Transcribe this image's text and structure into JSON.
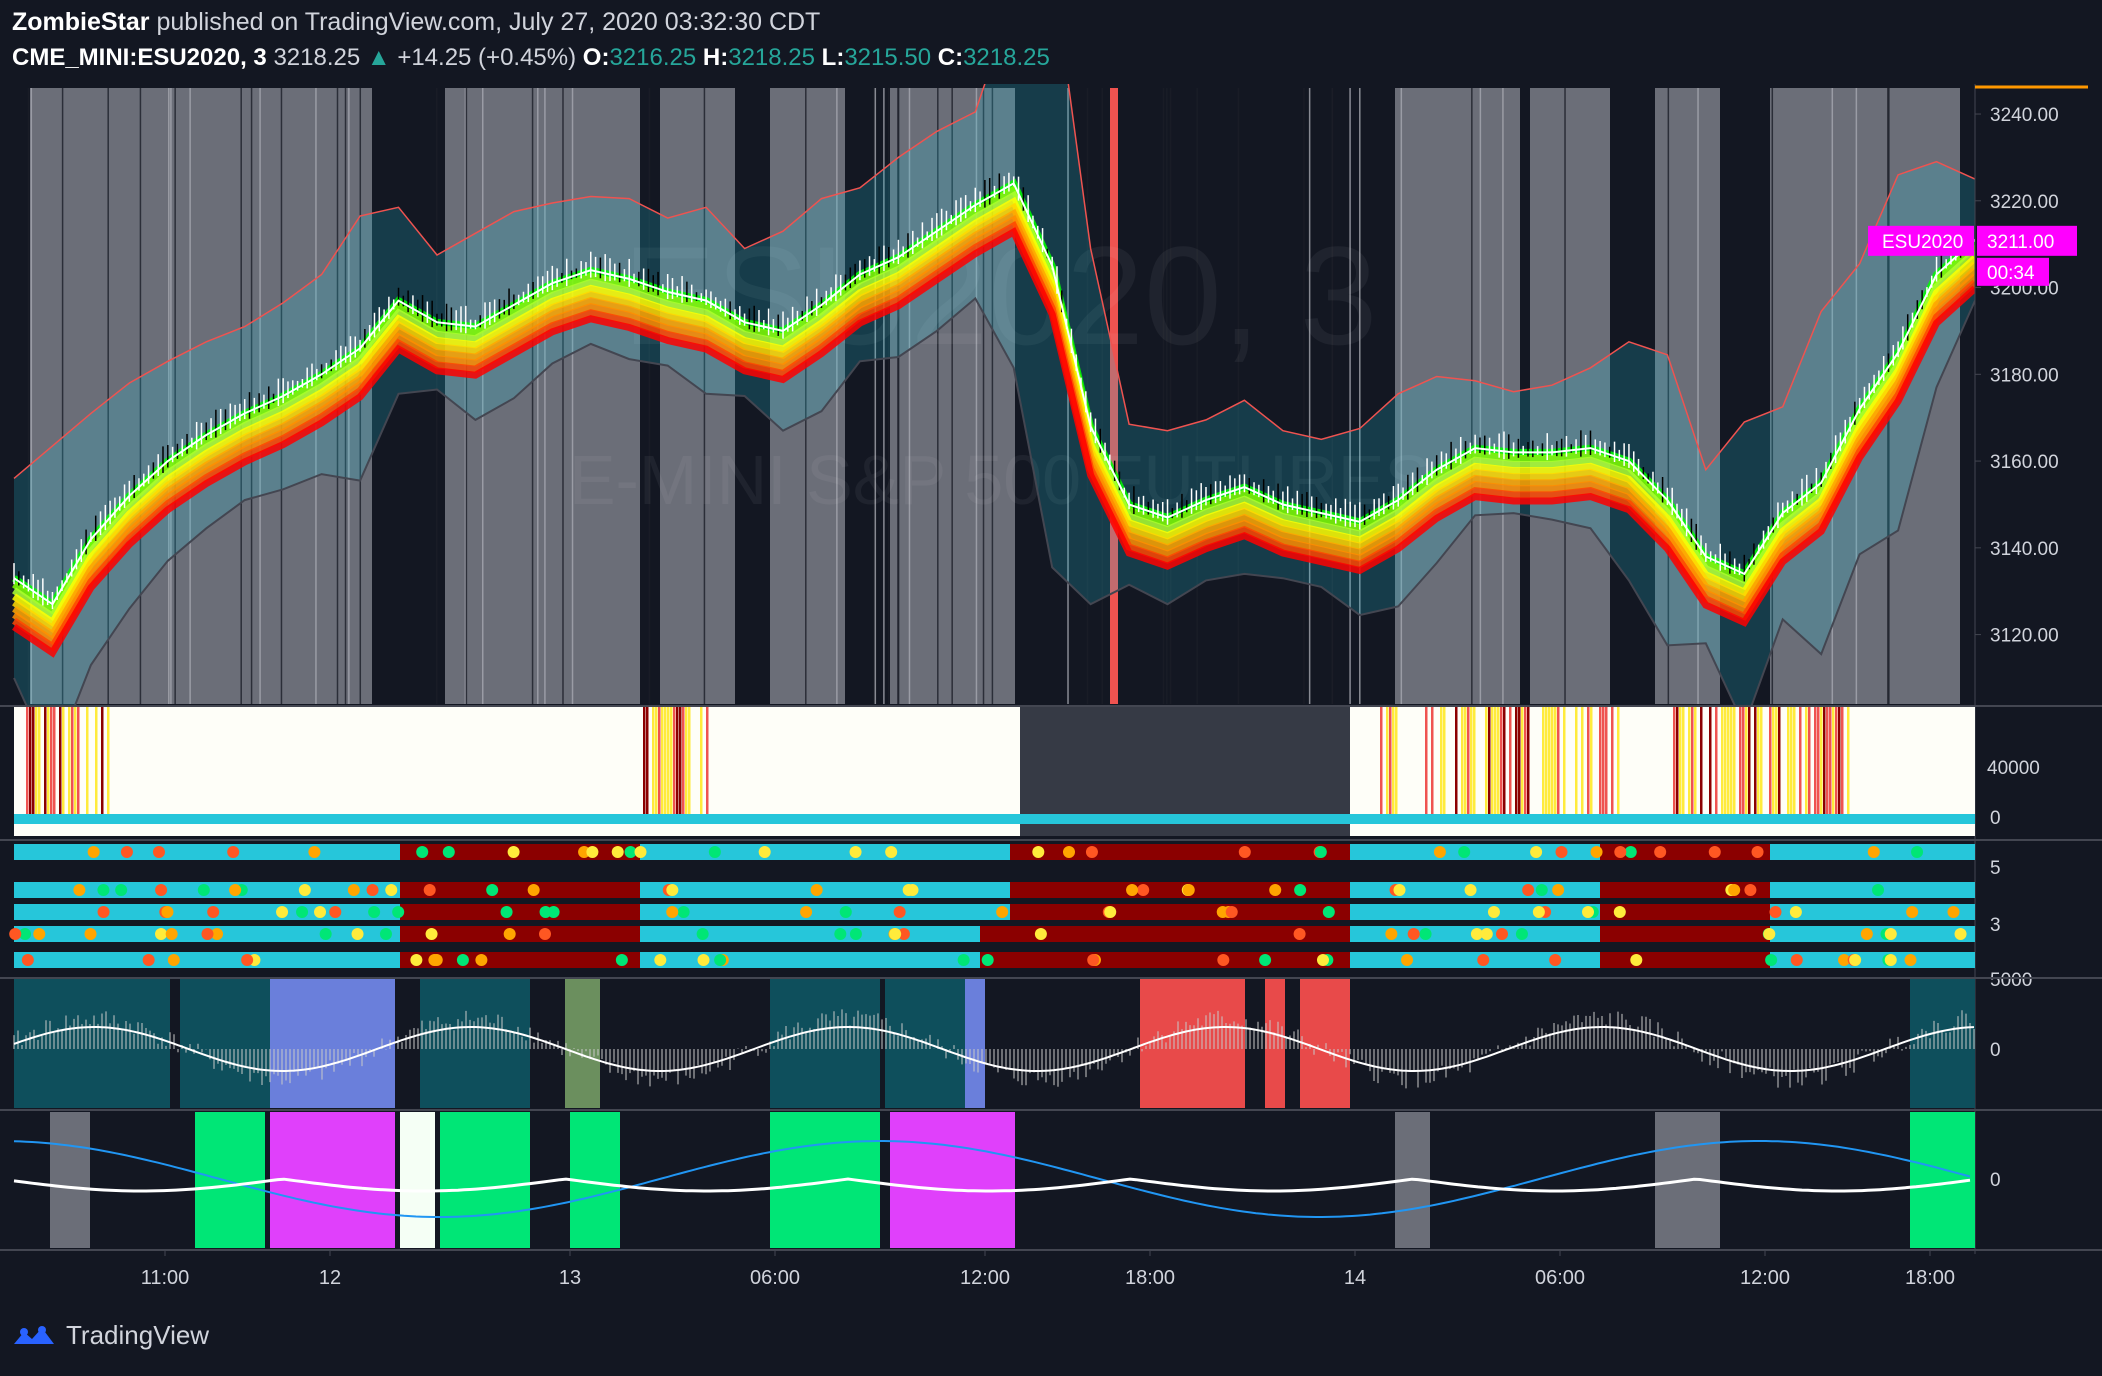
{
  "header": {
    "author": "ZombieStar",
    "published": "published on TradingView.com, July 27, 2020 03:32:30 CDT",
    "symbol": "CME_MINI:ESU2020, 3",
    "last": "3218.25",
    "change": "+14.25 (+0.45%)",
    "o_label": "O:",
    "o_value": "3216.25",
    "h_label": "H:",
    "h_value": "3218.25",
    "l_label": "L:",
    "l_value": "3215.50",
    "c_label": "C:",
    "c_value": "3218.25"
  },
  "watermark": {
    "line1": "ESU2020, 3",
    "line2": "E-MINI S&P 500 FUTURES"
  },
  "price_tag": {
    "symbol": "ESU2020",
    "price": "3211.00",
    "countdown": "00:34"
  },
  "colors": {
    "background": "#131722",
    "up": "#26a69a",
    "tag": "#ff00ff",
    "text": "#d1d4dc"
  },
  "footer": {
    "brand": "TradingView",
    "logo": "tradingview-logo-icon"
  },
  "chart_data": [
    {
      "type": "line",
      "pane": "price",
      "y_ticks": [
        "3240.00",
        "3220.00",
        "3200.00",
        "3180.00",
        "3160.00",
        "3140.00",
        "3120.00"
      ],
      "ylim": [
        3104,
        3246
      ],
      "x_ticks": [
        "11:00",
        "12",
        "13",
        "06:00",
        "12:00",
        "18:00",
        "14",
        "06:00",
        "12:00",
        "18:00"
      ],
      "series": [
        {
          "values": [
            3133,
            3127,
            3142,
            3152,
            3160,
            3166,
            3171,
            3175,
            3180,
            3186,
            3197,
            3192,
            3191,
            3196,
            3201,
            3204,
            3202,
            3199,
            3197,
            3192,
            3190,
            3196,
            3203,
            3207,
            3213,
            3219,
            3224,
            3205,
            3168,
            3150,
            3147,
            3151,
            3154,
            3150,
            3148,
            3146,
            3151,
            3158,
            3163,
            3162,
            3162,
            3163,
            3160,
            3151,
            3138,
            3134,
            3148,
            3155,
            3172,
            3185,
            3203,
            3211
          ]
        }
      ]
    },
    {
      "type": "bar",
      "pane": "volume",
      "y_ticks": [
        "40000",
        "0"
      ]
    },
    {
      "type": "heatmap",
      "pane": "ribbons",
      "y_ticks": [
        "5",
        "3"
      ]
    },
    {
      "type": "bar",
      "pane": "oscillator-1",
      "y_ticks": [
        "5000",
        "0"
      ]
    },
    {
      "type": "line",
      "pane": "oscillator-2",
      "y_ticks": [
        "0"
      ]
    }
  ]
}
